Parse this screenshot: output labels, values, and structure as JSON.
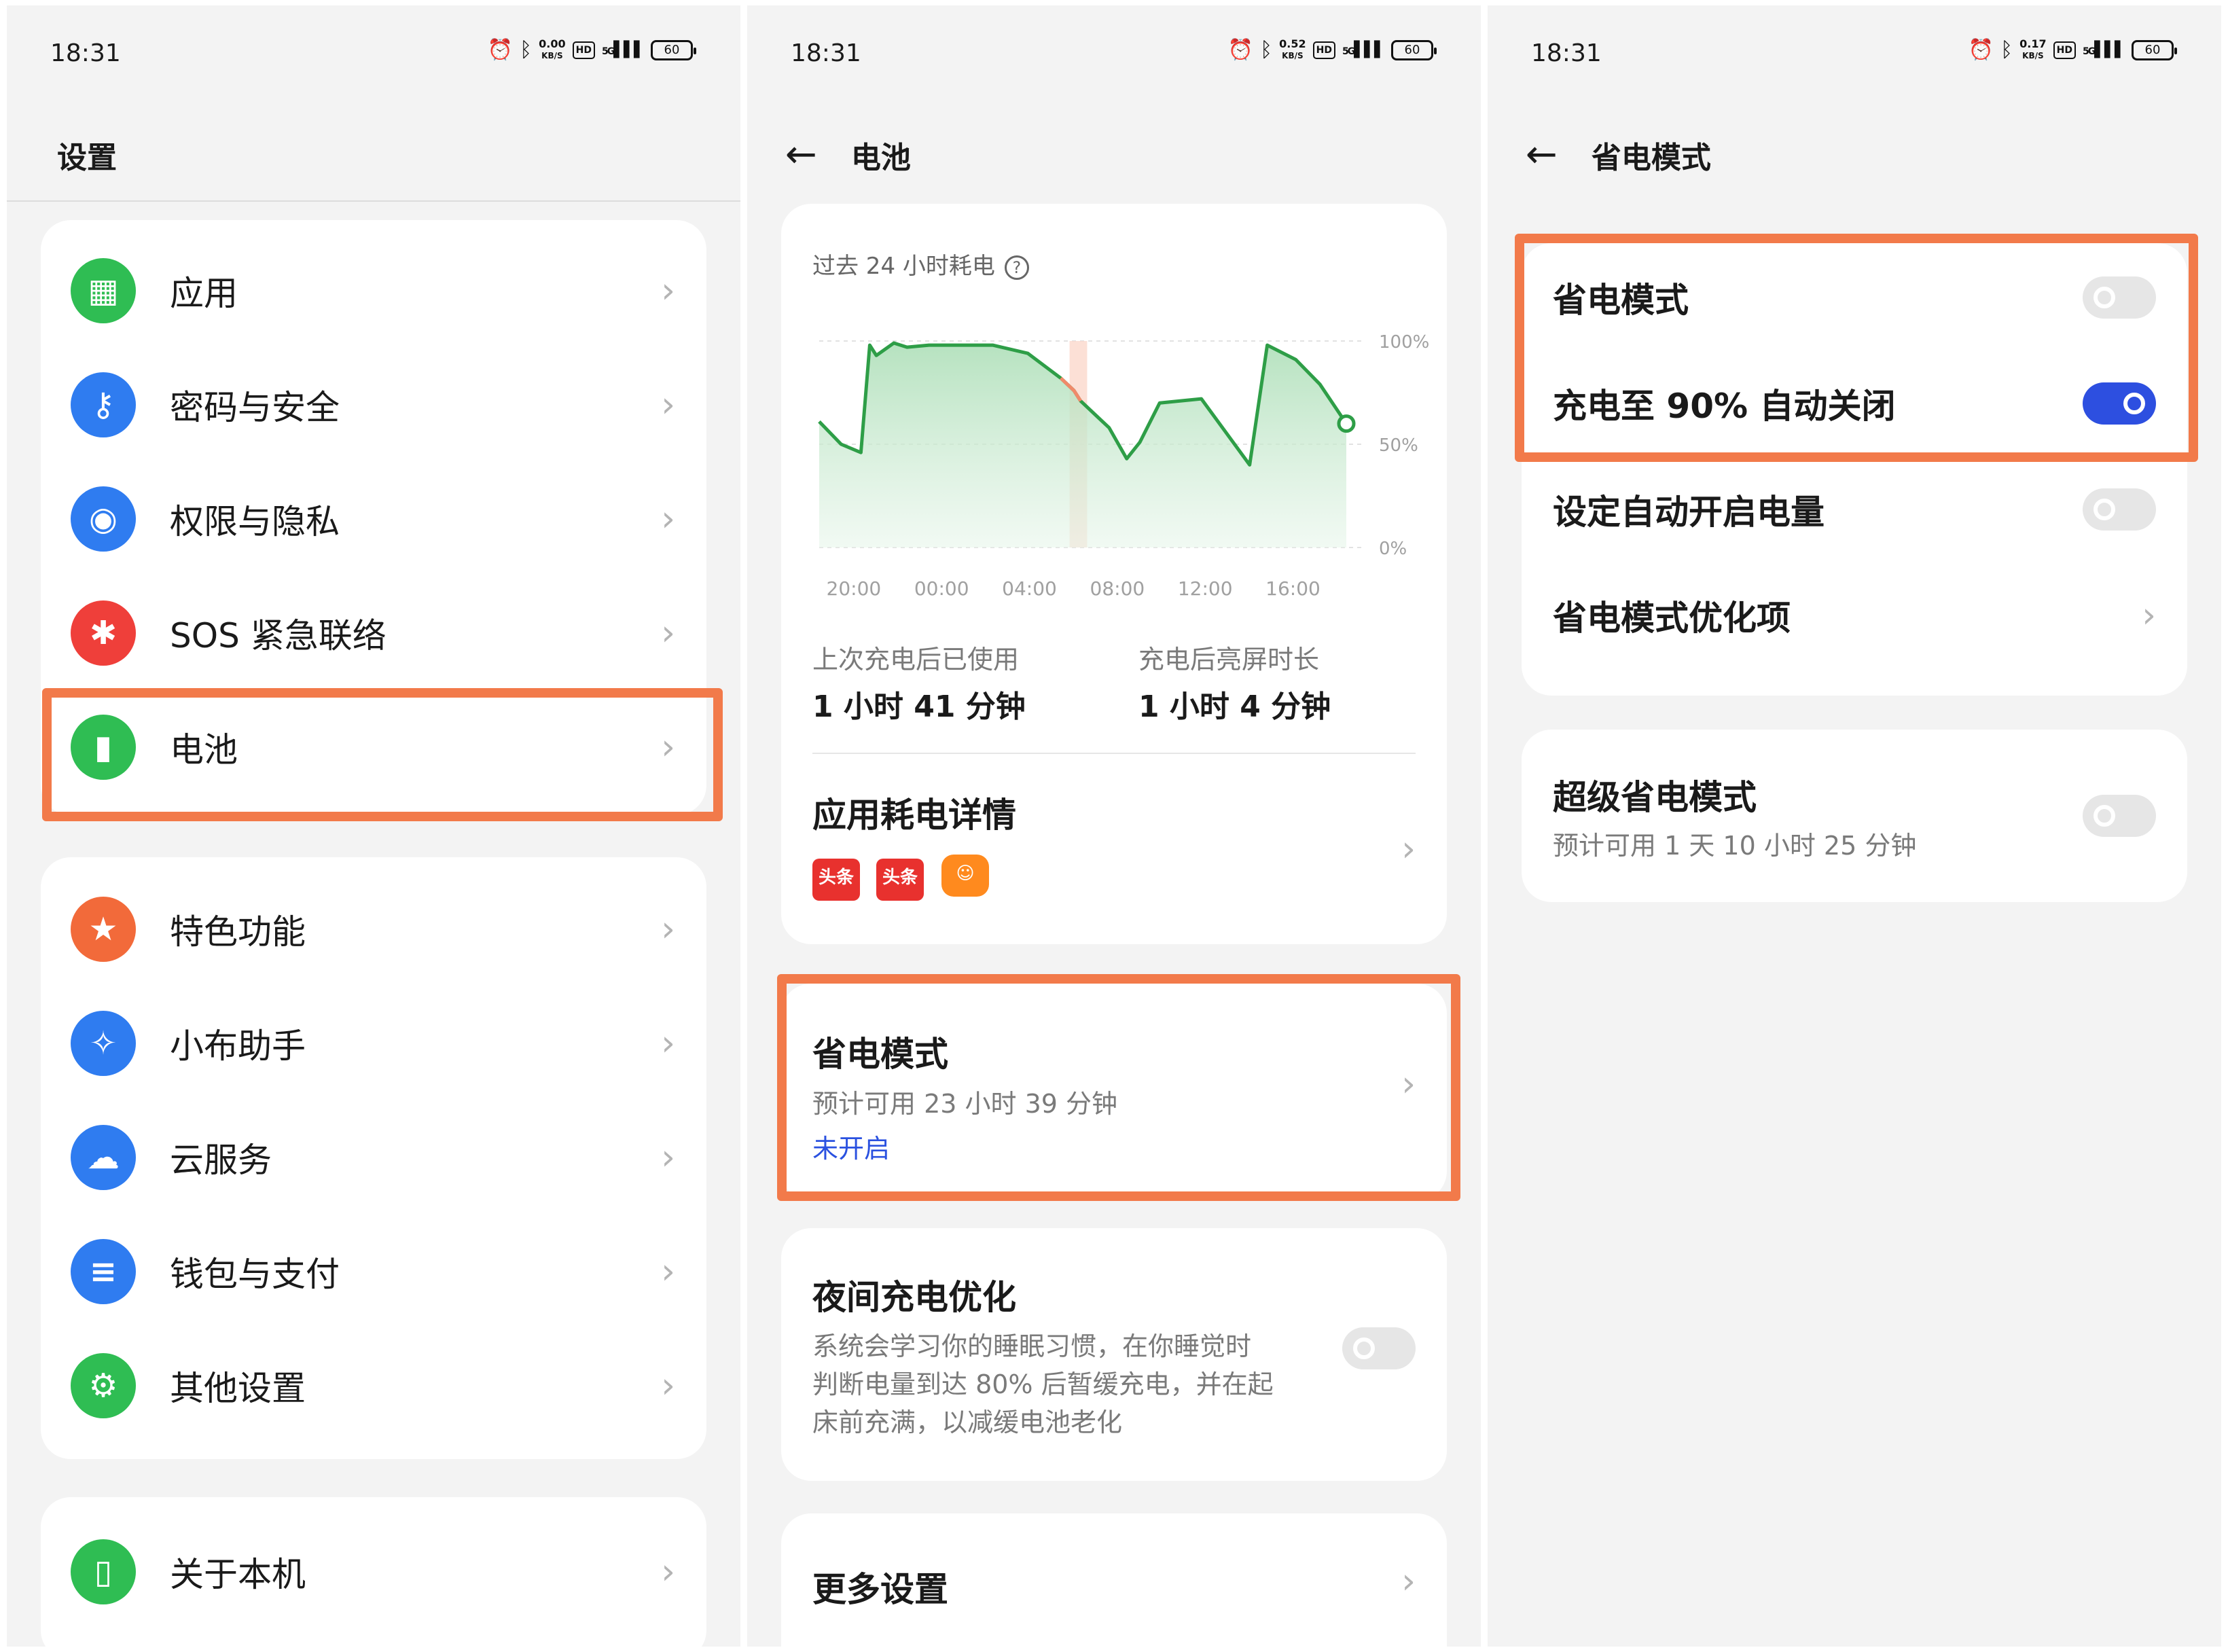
{
  "status": {
    "time": "18:31",
    "speeds": [
      "0.00",
      "0.52",
      "0.17"
    ],
    "speed_unit": "KB/S",
    "hd": "HD",
    "network": "5G",
    "battery": "60"
  },
  "p1": {
    "title": "设置",
    "group1": [
      "应用",
      "密码与安全",
      "权限与隐私",
      "SOS 紧急联络",
      "电池"
    ],
    "group2": [
      "特色功能",
      "小布助手",
      "云服务",
      "钱包与支付",
      "其他设置"
    ],
    "group3": [
      "关于本机"
    ]
  },
  "p2": {
    "title": "电池",
    "chart_title": "过去 24 小时耗电",
    "chart_data": {
      "type": "area",
      "title": "过去 24 小时耗电",
      "x_ticks": [
        "20:00",
        "00:00",
        "04:00",
        "08:00",
        "12:00",
        "16:00"
      ],
      "y_ticks": [
        "100%",
        "50%",
        "0%"
      ],
      "ylim": [
        0,
        100
      ],
      "x_hours": [
        0,
        1.0,
        1.9,
        2.3,
        2.6,
        3.4,
        4.0,
        5.0,
        7.9,
        9.5,
        11.0,
        11.6,
        11.9,
        12.7,
        13.2,
        14.0,
        14.6,
        15.5,
        17.4,
        19.6,
        20.4,
        21.7,
        22.8,
        24.0
      ],
      "values": [
        61,
        50,
        46,
        98,
        93,
        99,
        97,
        98,
        98,
        94,
        82,
        76,
        71,
        63,
        58,
        43,
        51,
        70,
        72,
        40,
        98,
        91,
        79,
        60
      ],
      "charging_band_hours": [
        11.4,
        12.2
      ],
      "grid": true
    },
    "used_label": "上次充电后已使用",
    "used_value": "1 小时 41 分钟",
    "screen_label": "充电后亮屏时长",
    "screen_value": "1 小时 4 分钟",
    "apps_title": "应用耗电详情",
    "app_icons": [
      "头条",
      "头条"
    ],
    "saver_title": "省电模式",
    "saver_est": "预计可用 23 小时 39 分钟",
    "saver_status": "未开启",
    "night_title": "夜间充电优化",
    "night_desc": [
      "系统会学习你的睡眠习惯，在你睡觉时",
      "判断电量到达 80% 后暂缓充电，并在起",
      "床前充满，以减缓电池老化"
    ],
    "more_title": "更多设置"
  },
  "p3": {
    "title": "省电模式",
    "items": [
      "省电模式",
      "充电至 90% 自动关闭",
      "设定自动开启电量",
      "省电模式优化项"
    ],
    "super_title": "超级省电模式",
    "super_est": "预计可用 1 天 10 小时 25 分钟"
  },
  "colors": {
    "highlight": "#f27a4a",
    "accent_blue": "#2d4fe0",
    "chart_line": "#2e9e47",
    "chart_charging": "#f08a6a"
  }
}
